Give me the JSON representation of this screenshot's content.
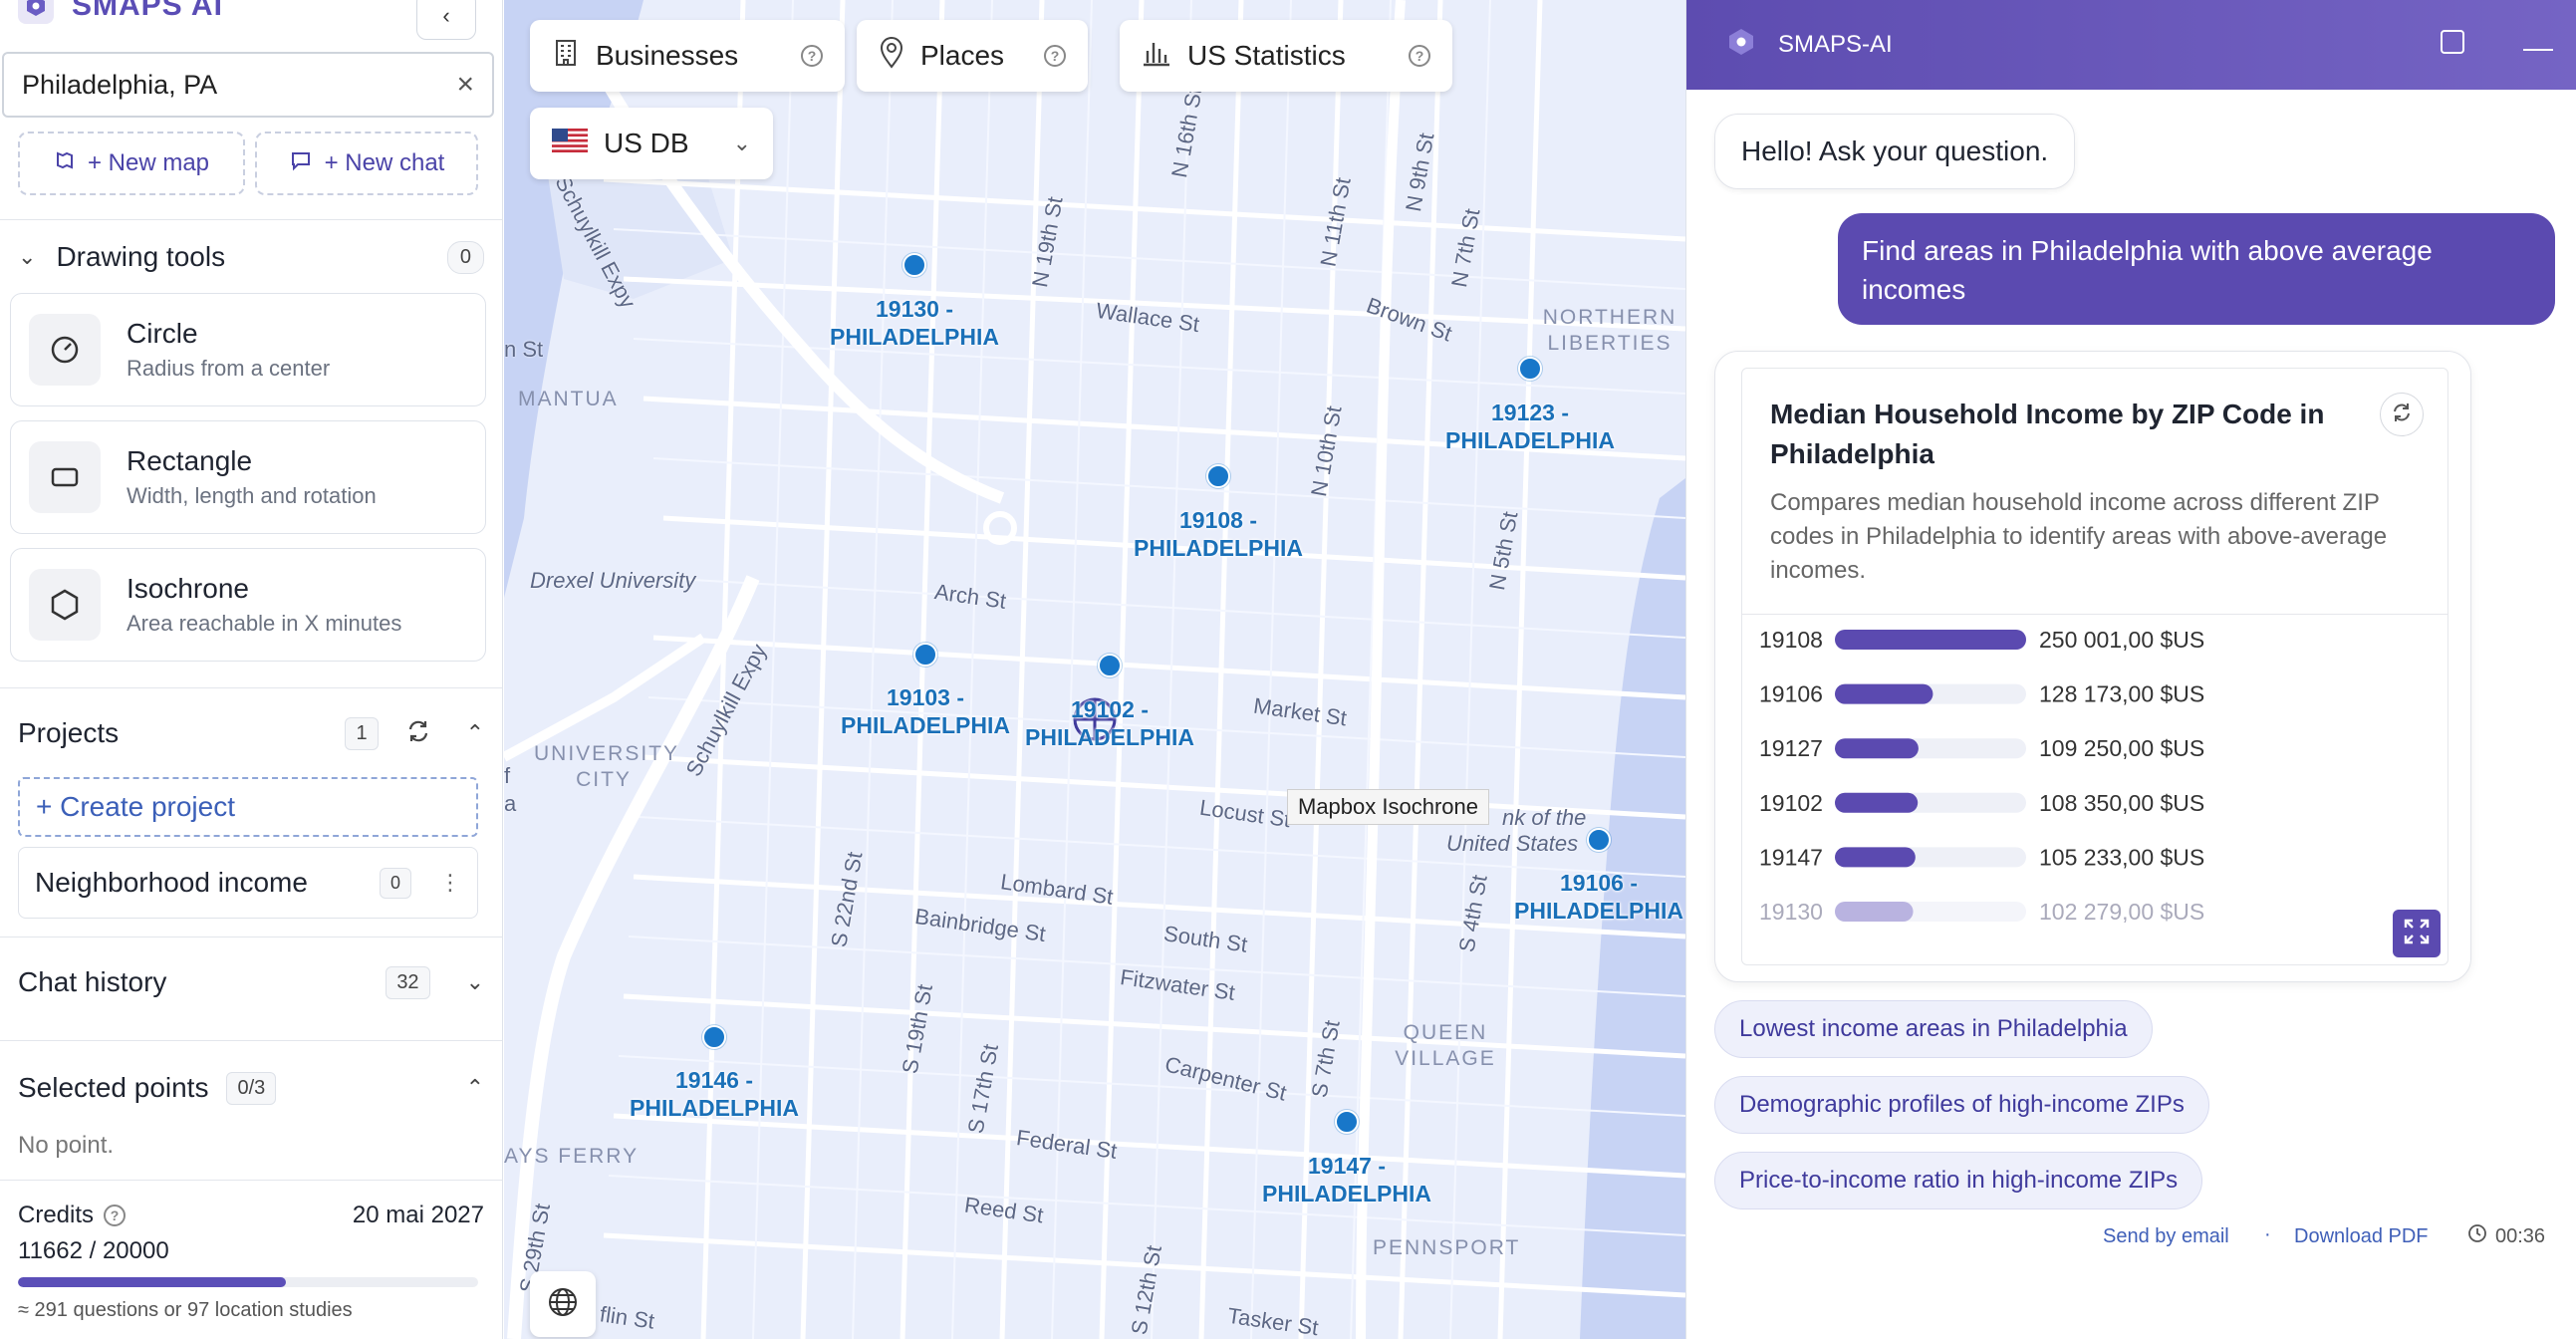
{
  "app": {
    "name": "SMAPS AI"
  },
  "sidebar": {
    "search": {
      "value": "Philadelphia, PA"
    },
    "new_map_label": "+ New map",
    "new_chat_label": "+ New chat",
    "drawing_tools": {
      "title": "Drawing tools",
      "count": "0",
      "tools": [
        {
          "title": "Circle",
          "subtitle": "Radius from a center",
          "icon": "clock-circle-icon"
        },
        {
          "title": "Rectangle",
          "subtitle": "Width, length and rotation",
          "icon": "rectangle-icon"
        },
        {
          "title": "Isochrone",
          "subtitle": "Area reachable in X minutes",
          "icon": "hexagon-icon"
        }
      ]
    },
    "projects": {
      "title": "Projects",
      "count": "1",
      "create_label": "+ Create project",
      "items": [
        {
          "name": "Neighborhood income",
          "count": "0"
        }
      ]
    },
    "chat_history": {
      "title": "Chat history",
      "count": "32"
    },
    "selected_points": {
      "title": "Selected points",
      "count": "0/3",
      "empty_text": "No point."
    },
    "credits": {
      "label": "Credits",
      "date": "20 mai 2027",
      "value_text": "11662 / 20000",
      "used": 11662,
      "total": 20000,
      "note": "≈ 291 questions or 97 location studies"
    }
  },
  "map": {
    "chips": {
      "businesses": "Businesses",
      "places": "Places",
      "us_statistics": "US Statistics",
      "db": "US DB"
    },
    "tooltip": "Mapbox Isochrone",
    "pins": [
      {
        "label_line1": "19130 -",
        "label_line2": "PHILADELPHIA"
      },
      {
        "label_line1": "19123 -",
        "label_line2": "PHILADELPHIA"
      },
      {
        "label_line1": "19108 -",
        "label_line2": "PHILADELPHIA"
      },
      {
        "label_line1": "19103 -",
        "label_line2": "PHILADELPHIA"
      },
      {
        "label_line1": "19102 -",
        "label_line2": "PHILADELPHIA"
      },
      {
        "label_line1": "19106 -",
        "label_line2": "PHILADELPHIA"
      },
      {
        "label_line1": "19146 -",
        "label_line2": "PHILADELPHIA"
      },
      {
        "label_line1": "19147 -",
        "label_line2": "PHILADELPHIA"
      }
    ],
    "streets": [
      "Schuylkill Expy",
      "Wallace St",
      "N 19th St",
      "N 16th St",
      "N 11th St",
      "N 9th St",
      "N 7th St",
      "Brown St",
      "Drexel University",
      "Arch St",
      "N 10th St",
      "N 5th St",
      "Schuylkill Expy",
      "Market St",
      "Locust St",
      "nk of the",
      "United States",
      "Lombard St",
      "Bainbridge St",
      "South St",
      "Fitzwater St",
      "Carpenter St",
      "S 22nd St",
      "S 19th St",
      "S 17th St",
      "S 7th St",
      "S 4th St",
      "Federal St",
      "Reed St",
      "S 29th St",
      "S 12th St",
      "Tasker St",
      "flin St",
      "n St",
      "f",
      "a"
    ],
    "areas": [
      "NORTHERN LIBERTIES",
      "MANTUA",
      "UNIVERSITY CITY",
      "QUEEN VILLAGE",
      "AYS FERRY",
      "PENNSPORT"
    ]
  },
  "chat": {
    "title": "SMAPS-AI",
    "greeting": "Hello! Ask your question.",
    "user_message": "Find areas in Philadelphia with above average incomes",
    "chart_card": {
      "title": "Median Household Income by ZIP Code in Philadelphia",
      "description": "Compares median household income across different ZIP codes in Philadelphia to identify areas with above-average incomes."
    },
    "suggestions": [
      "Lowest income areas in Philadelphia",
      "Demographic profiles of high-income ZIPs",
      "Price-to-income ratio in high-income ZIPs"
    ],
    "footer": {
      "send_email": "Send by email",
      "separator": "·",
      "download_pdf": "Download PDF",
      "time": "00:36"
    }
  },
  "colors": {
    "accent": "#5b4ab0",
    "pin": "#1877c9",
    "map_bg": "#e9eefb"
  },
  "chart_data": {
    "type": "bar",
    "orientation": "horizontal",
    "title": "Median Household Income by ZIP Code in Philadelphia",
    "categories": [
      "19108",
      "19106",
      "19127",
      "19102",
      "19147",
      "19130"
    ],
    "values": [
      250001,
      128173,
      109250,
      108350,
      105233,
      102279
    ],
    "value_labels": [
      "250 001,00 $US",
      "128 173,00 $US",
      "109 250,00 $US",
      "108 350,00 $US",
      "105 233,00 $US",
      "102 279,00 $US"
    ],
    "xlim": [
      0,
      250001
    ],
    "grid": false
  }
}
